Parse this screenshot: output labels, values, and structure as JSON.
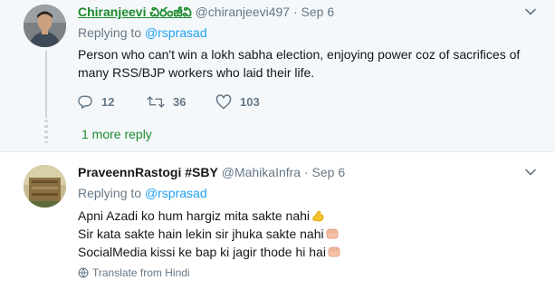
{
  "reply1": {
    "display_name": "Chiranjeevi",
    "display_name_suffix": "చిరంజీవి",
    "handle": "@chiranjeevi497",
    "separator": "·",
    "time": "Sep 6",
    "replying_prefix": "Replying to",
    "replying_to": "@rsprasad",
    "text_line1": "Person who can't win a lokh sabha election, enjoying power coz of sacrifices of",
    "text_line2": "many RSS/BJP workers who laid their life.",
    "reply_count": "12",
    "retweet_count": "36",
    "like_count": "103"
  },
  "more_replies_label": "1 more reply",
  "reply2": {
    "display_name": "PraveennRastogi #SBY",
    "handle": "@MahikaInfra",
    "separator": "·",
    "time": "Sep 6",
    "replying_prefix": "Replying to",
    "replying_to": "@rsprasad",
    "line1": "Apni Azadi ko hum hargiz mita sakte nahi",
    "line2": "Sir kata sakte hain lekin sir jhuka sakte nahi",
    "line3": "SocialMedia kissi ke bap ki jagir thode hi hai",
    "translate_label": "Translate from Hindi"
  },
  "icons": {
    "reply": "reply-icon",
    "retweet": "retweet-icon",
    "like": "heart-icon",
    "caret": "chevron-down-icon",
    "emoji_muscle": "flexed-biceps-emoji",
    "emoji_fist": "oncoming-fist-emoji",
    "translate": "globe-icon"
  },
  "colors": {
    "link_green": "#1b8a2e",
    "mention_blue": "#1da1f2",
    "muted": "#657786",
    "thread_bg": "#f5f8fa"
  }
}
